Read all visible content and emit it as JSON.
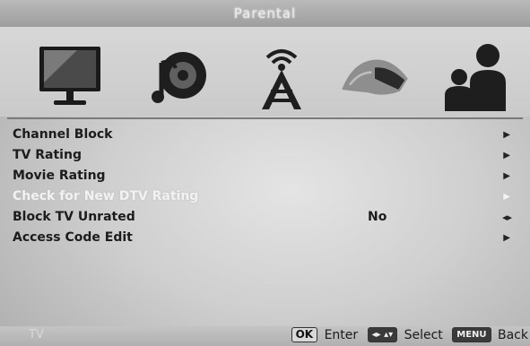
{
  "header": {
    "title": "Parental"
  },
  "icons": [
    "tv-monitor-icon",
    "audio-speaker-icon",
    "antenna-tower-icon",
    "hand-settings-icon",
    "parental-people-icon"
  ],
  "menu": {
    "items": [
      {
        "label": "Channel Block",
        "arrow": "▶"
      },
      {
        "label": "TV Rating",
        "arrow": "▶"
      },
      {
        "label": "Movie Rating",
        "arrow": "▶"
      },
      {
        "label": "Check for New DTV Rating",
        "arrow": "▶"
      },
      {
        "label": "Block TV Unrated",
        "value": "No",
        "lr": "◂▸"
      },
      {
        "label": "Access Code Edit",
        "arrow": "▶"
      }
    ]
  },
  "footer": {
    "source": "TV",
    "ok_key": "OK",
    "enter_label": "Enter",
    "nav_key": "◂▸ ▴▾",
    "select_label": "Select",
    "menu_key": "MENU",
    "back_label": "Back"
  }
}
